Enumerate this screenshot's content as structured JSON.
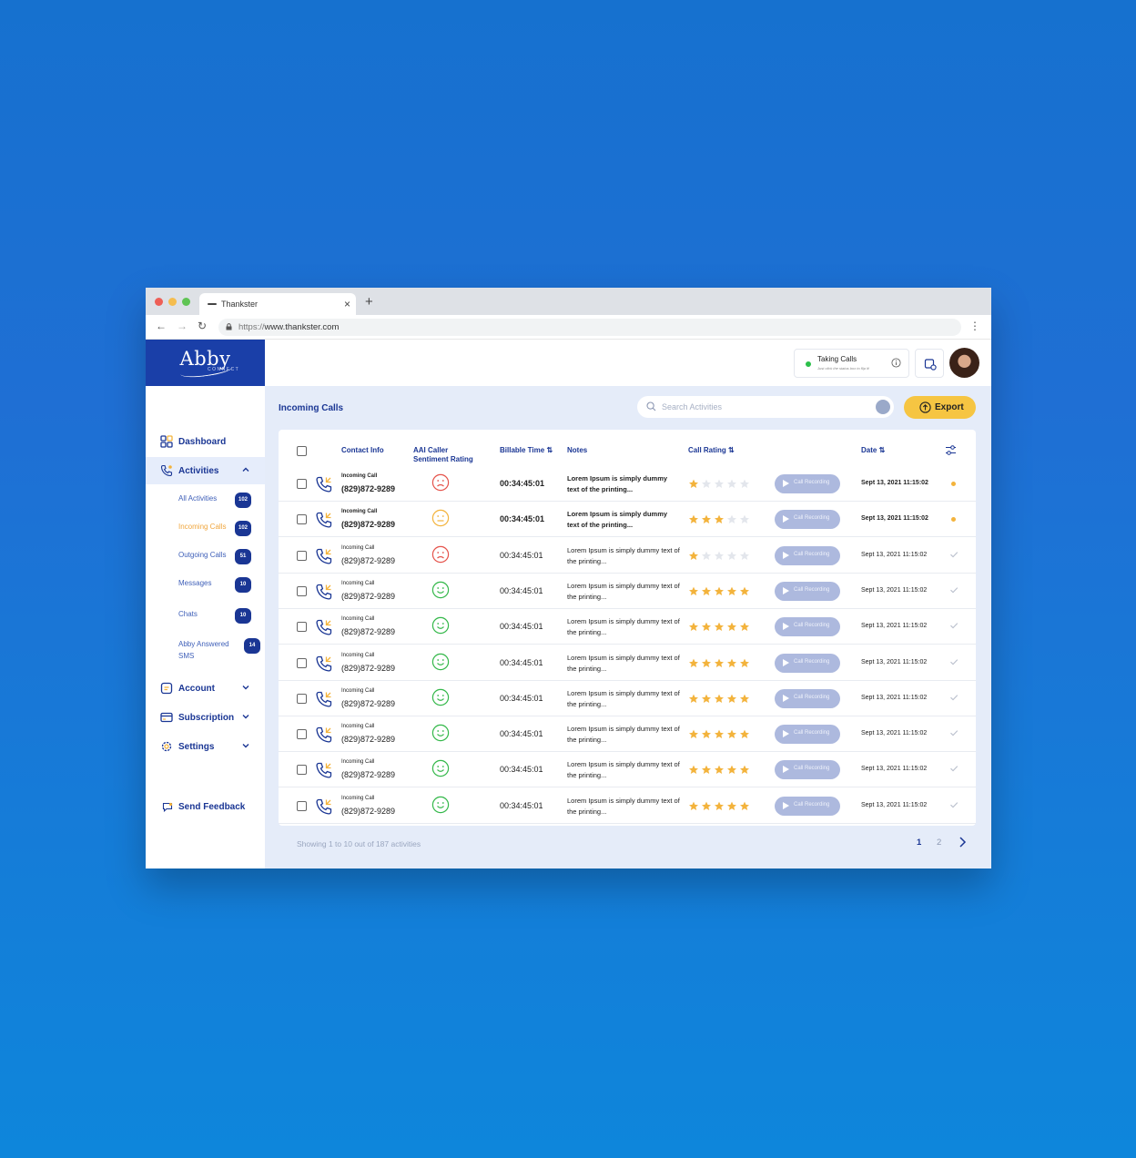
{
  "browser": {
    "tab_title": "Thankster",
    "url_proto": "https://",
    "url_host": "www.thankster.com"
  },
  "brand": {
    "name": "Abby",
    "sub": "CONNECT"
  },
  "status": {
    "title": "Taking Calls",
    "hint": "Just click the status box to flip it!"
  },
  "sidebar": {
    "dashboard": "Dashboard",
    "activities": "Activities",
    "sub_items": [
      {
        "label": "All Activities",
        "count": "102"
      },
      {
        "label": "Incoming Calls",
        "count": "102"
      },
      {
        "label": "Outgoing Calls",
        "count": "51"
      },
      {
        "label": "Messages",
        "count": "10"
      },
      {
        "label": "Chats",
        "count": "10"
      },
      {
        "label": "Abby Answered SMS",
        "count": "14"
      }
    ],
    "account": "Account",
    "subscription": "Subscription",
    "settings": "Settings",
    "feedback": "Send Feedback"
  },
  "page": {
    "title": "Incoming Calls",
    "search_placeholder": "Search Activities",
    "export_label": "Export"
  },
  "table": {
    "headers": {
      "contact": "Contact Info",
      "sentiment": "AAI Caller Sentiment Rating",
      "billable": "Billable Time",
      "notes": "Notes",
      "rating": "Call Rating",
      "date": "Date"
    },
    "recording_label": "Call Recording",
    "rows": [
      {
        "type": "Incoming Call",
        "phone": "(829)872-9289",
        "sentiment": "sad",
        "time": "00:34:45:01",
        "note": "Lorem Ipsum is simply dummy text of the printing...",
        "rating": 1,
        "date": "Sept 13, 2021  11:15:02",
        "unread": true
      },
      {
        "type": "Incoming Call",
        "phone": "(829)872-9289",
        "sentiment": "neutral",
        "time": "00:34:45:01",
        "note": "Lorem Ipsum is simply dummy text of the printing...",
        "rating": 3,
        "date": "Sept 13, 2021  11:15:02",
        "unread": true
      },
      {
        "type": "Incoming Call",
        "phone": "(829)872-9289",
        "sentiment": "sad",
        "time": "00:34:45:01",
        "note": "Lorem Ipsum is simply dummy text of the printing...",
        "rating": 1,
        "date": "Sept 13, 2021  11:15:02",
        "unread": false
      },
      {
        "type": "Incoming Call",
        "phone": "(829)872-9289",
        "sentiment": "happy",
        "time": "00:34:45:01",
        "note": "Lorem Ipsum is simply dummy text of the printing...",
        "rating": 5,
        "date": "Sept 13, 2021  11:15:02",
        "unread": false
      },
      {
        "type": "Incoming Call",
        "phone": "(829)872-9289",
        "sentiment": "happy",
        "time": "00:34:45:01",
        "note": "Lorem Ipsum is simply dummy text of the printing...",
        "rating": 5,
        "date": "Sept 13, 2021  11:15:02",
        "unread": false
      },
      {
        "type": "Incoming Call",
        "phone": "(829)872-9289",
        "sentiment": "happy",
        "time": "00:34:45:01",
        "note": "Lorem Ipsum is simply dummy text of the printing...",
        "rating": 5,
        "date": "Sept 13, 2021  11:15:02",
        "unread": false
      },
      {
        "type": "Incoming Call",
        "phone": "(829)872-9289",
        "sentiment": "happy",
        "time": "00:34:45:01",
        "note": "Lorem Ipsum is simply dummy text of the printing...",
        "rating": 5,
        "date": "Sept 13, 2021  11:15:02",
        "unread": false
      },
      {
        "type": "Incoming Call",
        "phone": "(829)872-9289",
        "sentiment": "happy",
        "time": "00:34:45:01",
        "note": "Lorem Ipsum is simply dummy text of the printing...",
        "rating": 5,
        "date": "Sept 13, 2021  11:15:02",
        "unread": false
      },
      {
        "type": "Incoming Call",
        "phone": "(829)872-9289",
        "sentiment": "happy",
        "time": "00:34:45:01",
        "note": "Lorem Ipsum is simply dummy text of the printing...",
        "rating": 5,
        "date": "Sept 13, 2021  11:15:02",
        "unread": false
      },
      {
        "type": "Incoming Call",
        "phone": "(829)872-9289",
        "sentiment": "happy",
        "time": "00:34:45:01",
        "note": "Lorem Ipsum is simply dummy text of the printing...",
        "rating": 5,
        "date": "Sept 13, 2021  11:15:02",
        "unread": false
      }
    ]
  },
  "footer": {
    "showing": "Showing 1 to 10 out of 187 activities",
    "pages": [
      "1",
      "2"
    ],
    "current_page": "1"
  },
  "colors": {
    "primary": "#1a3694",
    "accent": "#f6c542",
    "star": "#f3b33c",
    "sad": "#e5534b",
    "neutral": "#f3b33c",
    "happy": "#34b84a"
  }
}
